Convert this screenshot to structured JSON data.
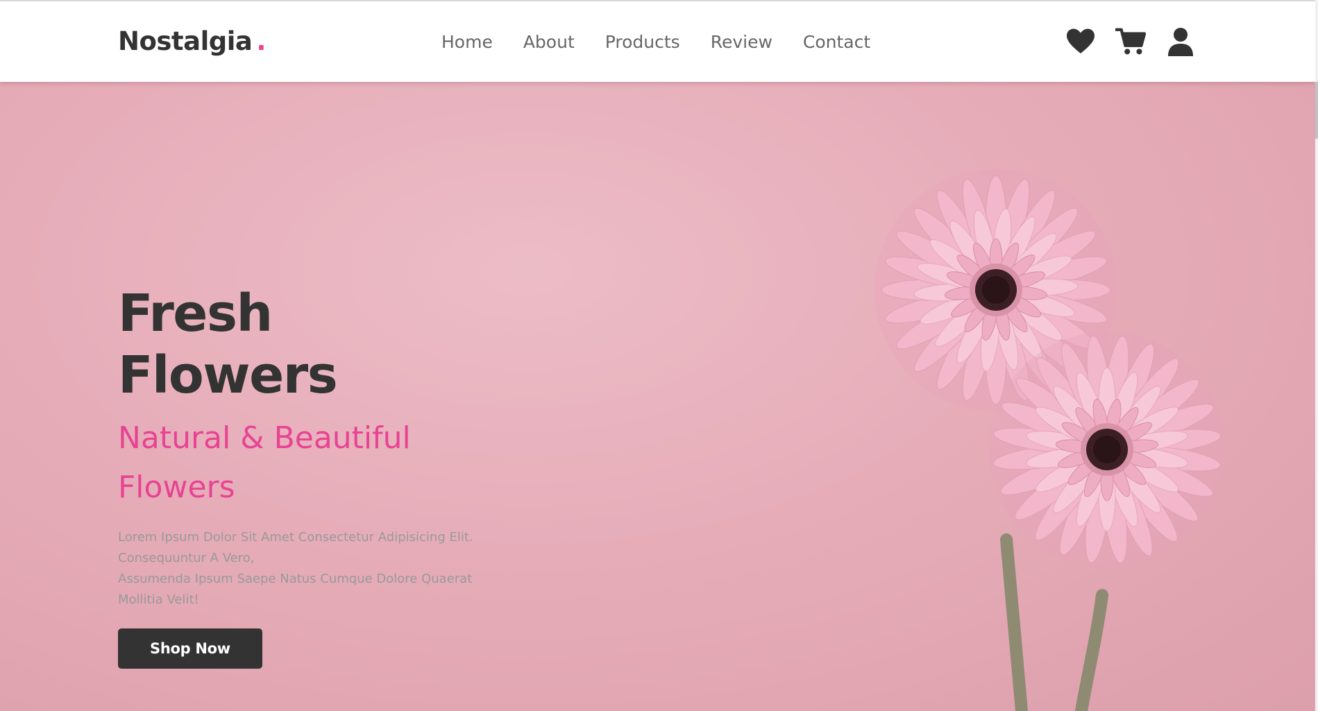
{
  "header": {
    "logo_text": "Nostalgia",
    "logo_dot": ".",
    "nav": [
      {
        "label": "Home"
      },
      {
        "label": "About"
      },
      {
        "label": "Products"
      },
      {
        "label": "Review"
      },
      {
        "label": "Contact"
      }
    ],
    "icons": [
      "heart-icon",
      "cart-icon",
      "user-icon"
    ]
  },
  "hero": {
    "title": "Fresh Flowers",
    "subtitle": "Natural & Beautiful Flowers",
    "description_line1": "Lorem Ipsum Dolor Sit Amet Consectetur Adipisicing Elit. Consequuntur A Vero,",
    "description_line2": "Assumenda Ipsum Saepe Natus Cumque Dolore Quaerat Mollitia Velit!",
    "button_label": "Shop Now"
  },
  "colors": {
    "accent": "#e84393",
    "dark": "#333333",
    "hero_background": "#e6adb9",
    "text_muted": "#999999",
    "nav_text": "#666666"
  }
}
